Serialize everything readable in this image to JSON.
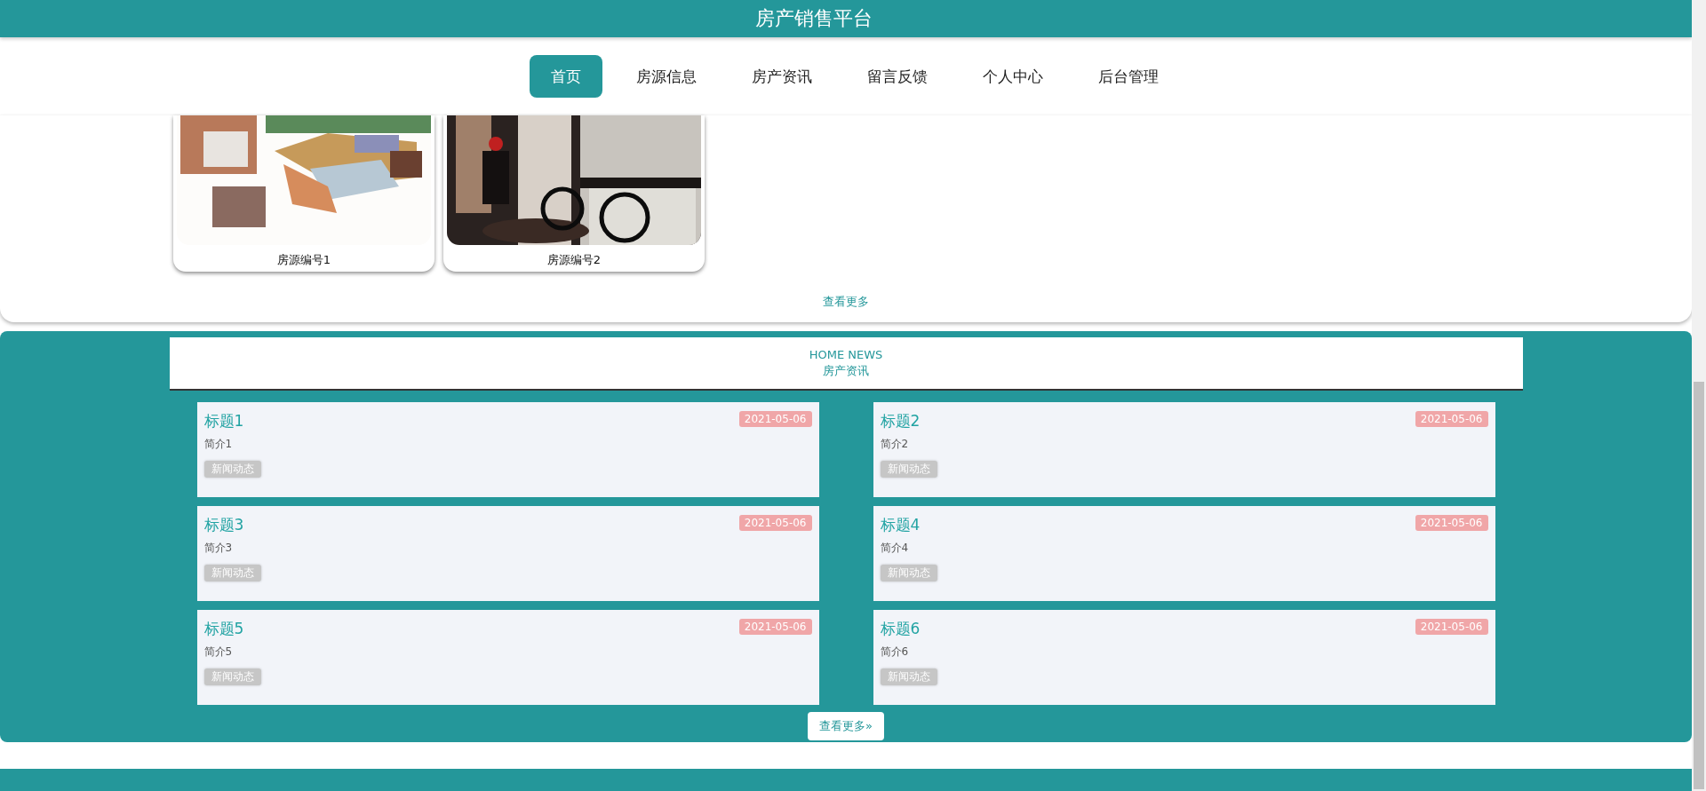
{
  "header": {
    "title": "房产销售平台"
  },
  "nav": [
    {
      "label": "首页",
      "selected": true
    },
    {
      "label": "房源信息",
      "selected": false
    },
    {
      "label": "房产资讯",
      "selected": false
    },
    {
      "label": "留言反馈",
      "selected": false
    },
    {
      "label": "个人中心",
      "selected": false
    },
    {
      "label": "后台管理",
      "selected": false
    }
  ],
  "houses": {
    "items": [
      {
        "kind": "picture",
        "caption": "房源编号1"
      },
      {
        "kind": "picture",
        "caption": "房源编号2"
      }
    ],
    "more": "查看更多"
  },
  "news": {
    "subtitle": "HOME NEWS",
    "title": "房产资讯",
    "items": [
      {
        "title": "标题1",
        "intro": "简介1",
        "tag": "新闻动态",
        "date": "2021-05-06"
      },
      {
        "title": "标题2",
        "intro": "简介2",
        "tag": "新闻动态",
        "date": "2021-05-06"
      },
      {
        "title": "标题3",
        "intro": "简介3",
        "tag": "新闻动态",
        "date": "2021-05-06"
      },
      {
        "title": "标题4",
        "intro": "简介4",
        "tag": "新闻动态",
        "date": "2021-05-06"
      },
      {
        "title": "标题5",
        "intro": "简介5",
        "tag": "新闻动态",
        "date": "2021-05-06"
      },
      {
        "title": "标题6",
        "intro": "简介6",
        "tag": "新闻动态",
        "date": "2021-05-06"
      }
    ],
    "more": "查看更多»"
  }
}
